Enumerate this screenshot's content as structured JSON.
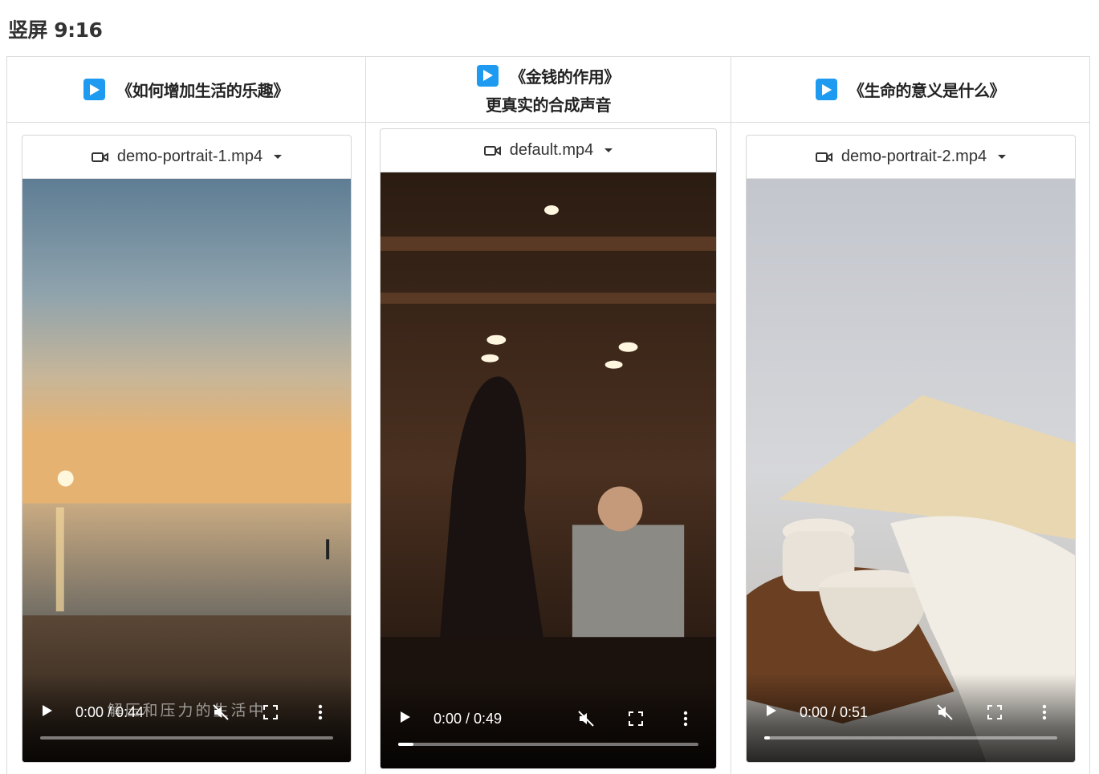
{
  "page": {
    "title": "竖屏 9:16"
  },
  "columns": [
    {
      "title": "《如何增加生活的乐趣》",
      "subtitle": "",
      "file": "demo-portrait-1.mp4",
      "time": "0:00 / 0:44",
      "progress": 0,
      "caption": "解压和压力的生活中"
    },
    {
      "title": "《金钱的作用》",
      "subtitle": "更真实的合成声音",
      "file": "default.mp4",
      "time": "0:00 / 0:49",
      "progress": 0.05,
      "caption": ""
    },
    {
      "title": "《生命的意义是什么》",
      "subtitle": "",
      "file": "demo-portrait-2.mp4",
      "time": "0:00 / 0:51",
      "progress": 0.02,
      "caption": ""
    }
  ],
  "icons": {
    "header": "play-badge-icon",
    "file": "video-camera-icon",
    "dropdown": "caret-down-icon",
    "play": "play-icon",
    "mute": "volume-muted-icon",
    "fullscreen": "fullscreen-icon",
    "menu": "more-vertical-icon"
  },
  "colors": {
    "accent": "#1e9bf0",
    "border": "#dcdcdc"
  }
}
